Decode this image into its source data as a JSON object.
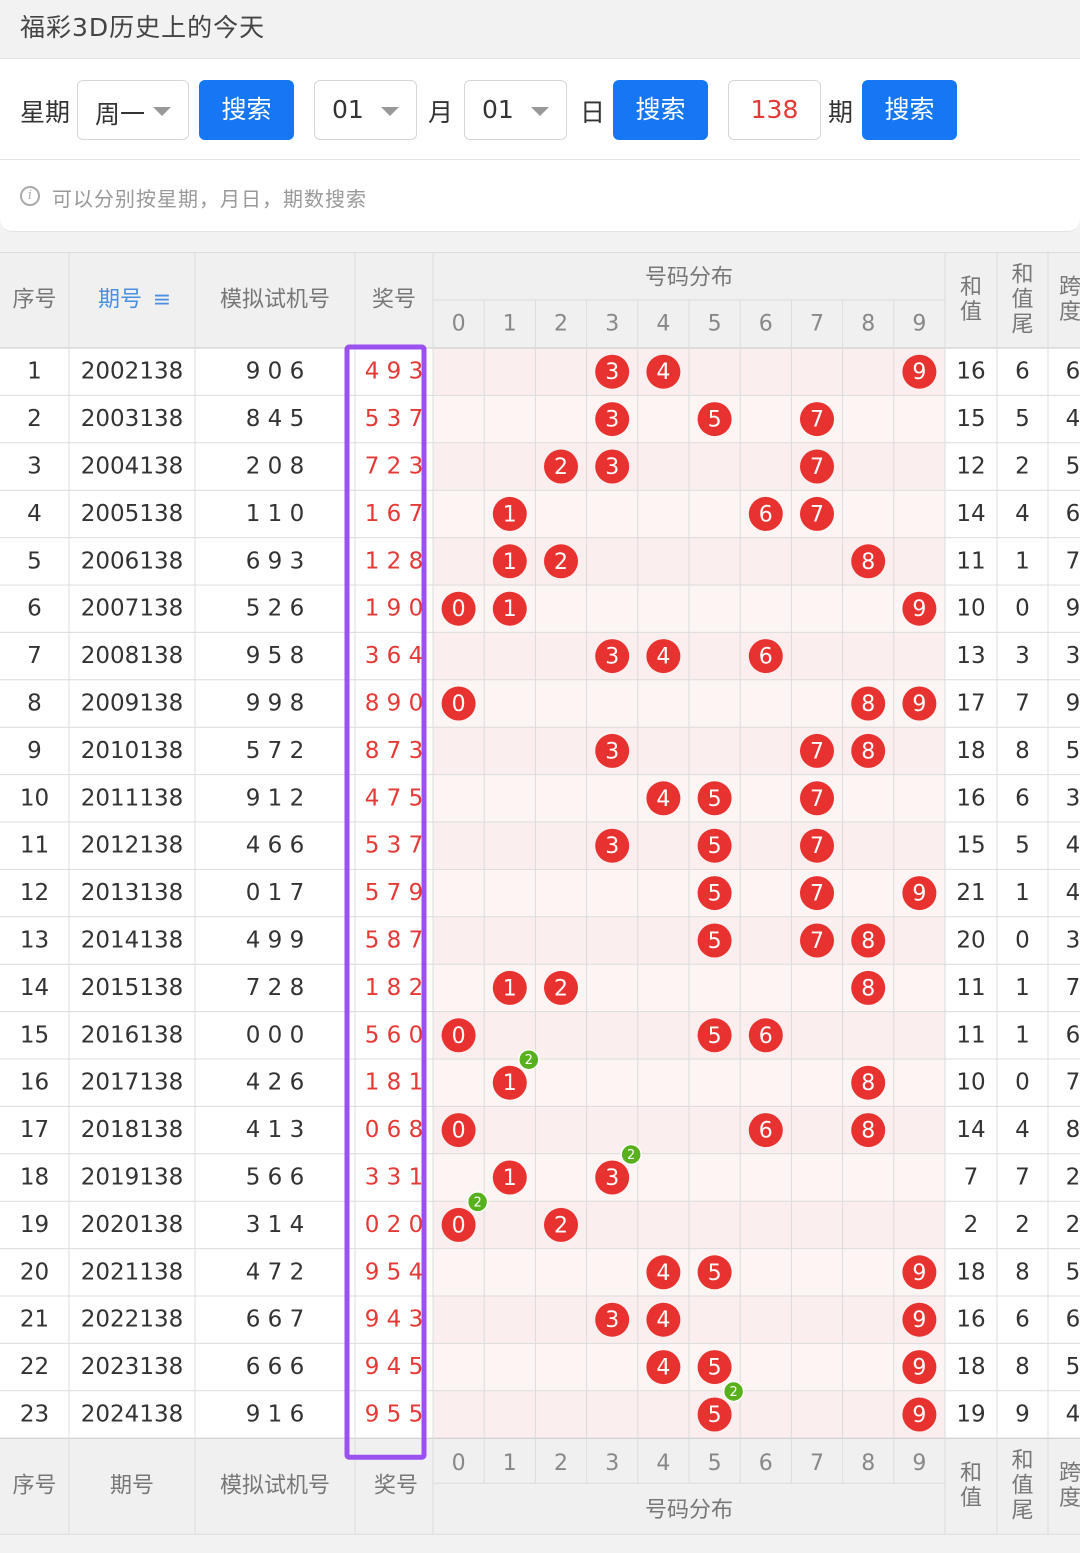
{
  "page": {
    "title": "福彩3D历史上的今天"
  },
  "search": {
    "weekday_label": "星期",
    "weekday_value": "周一",
    "search_label": "搜索",
    "month_value": "01",
    "month_label": "月",
    "day_value": "01",
    "day_label": "日",
    "issue_value": "138",
    "issue_label": "期"
  },
  "hint": "可以分别按星期，月日，期数搜索",
  "table": {
    "header": {
      "seq": "序号",
      "issue": "期号",
      "sort_icon": "≡",
      "trial": "模拟试机号",
      "prize": "奖号",
      "dist": "号码分布",
      "digits": [
        "0",
        "1",
        "2",
        "3",
        "4",
        "5",
        "6",
        "7",
        "8",
        "9"
      ],
      "sum": "和值",
      "sum_tail": "和值尾",
      "span": "跨度"
    },
    "footer": {
      "seq": "序号",
      "issue": "期号",
      "trial": "模拟试机号",
      "prize": "奖号",
      "dist": "号码分布",
      "sum": "和值",
      "sum_tail": "和值尾",
      "span": "跨度"
    },
    "rows": [
      {
        "seq": "1",
        "issue": "2002138",
        "trial": "9 0 6",
        "prize": "4 9 3",
        "sum": "16",
        "tail": "6",
        "span": "6"
      },
      {
        "seq": "2",
        "issue": "2003138",
        "trial": "8 4 5",
        "prize": "5 3 7",
        "sum": "15",
        "tail": "5",
        "span": "4"
      },
      {
        "seq": "3",
        "issue": "2004138",
        "trial": "2 0 8",
        "prize": "7 2 3",
        "sum": "12",
        "tail": "2",
        "span": "5"
      },
      {
        "seq": "4",
        "issue": "2005138",
        "trial": "1 1 0",
        "prize": "1 6 7",
        "sum": "14",
        "tail": "4",
        "span": "6"
      },
      {
        "seq": "5",
        "issue": "2006138",
        "trial": "6 9 3",
        "prize": "1 2 8",
        "sum": "11",
        "tail": "1",
        "span": "7"
      },
      {
        "seq": "6",
        "issue": "2007138",
        "trial": "5 2 6",
        "prize": "1 9 0",
        "sum": "10",
        "tail": "0",
        "span": "9"
      },
      {
        "seq": "7",
        "issue": "2008138",
        "trial": "9 5 8",
        "prize": "3 6 4",
        "sum": "13",
        "tail": "3",
        "span": "3"
      },
      {
        "seq": "8",
        "issue": "2009138",
        "trial": "9 9 8",
        "prize": "8 9 0",
        "sum": "17",
        "tail": "7",
        "span": "9"
      },
      {
        "seq": "9",
        "issue": "2010138",
        "trial": "5 7 2",
        "prize": "8 7 3",
        "sum": "18",
        "tail": "8",
        "span": "5"
      },
      {
        "seq": "10",
        "issue": "2011138",
        "trial": "9 1 2",
        "prize": "4 7 5",
        "sum": "16",
        "tail": "6",
        "span": "3"
      },
      {
        "seq": "11",
        "issue": "2012138",
        "trial": "4 6 6",
        "prize": "5 3 7",
        "sum": "15",
        "tail": "5",
        "span": "4"
      },
      {
        "seq": "12",
        "issue": "2013138",
        "trial": "0 1 7",
        "prize": "5 7 9",
        "sum": "21",
        "tail": "1",
        "span": "4"
      },
      {
        "seq": "13",
        "issue": "2014138",
        "trial": "4 9 9",
        "prize": "5 8 7",
        "sum": "20",
        "tail": "0",
        "span": "3"
      },
      {
        "seq": "14",
        "issue": "2015138",
        "trial": "7 2 8",
        "prize": "1 8 2",
        "sum": "11",
        "tail": "1",
        "span": "7"
      },
      {
        "seq": "15",
        "issue": "2016138",
        "trial": "0 0 0",
        "prize": "5 6 0",
        "sum": "11",
        "tail": "1",
        "span": "6"
      },
      {
        "seq": "16",
        "issue": "2017138",
        "trial": "4 2 6",
        "prize": "1 8 1",
        "sum": "10",
        "tail": "0",
        "span": "7"
      },
      {
        "seq": "17",
        "issue": "2018138",
        "trial": "4 1 3",
        "prize": "0 6 8",
        "sum": "14",
        "tail": "4",
        "span": "8"
      },
      {
        "seq": "18",
        "issue": "2019138",
        "trial": "5 6 6",
        "prize": "3 3 1",
        "sum": "7",
        "tail": "7",
        "span": "2"
      },
      {
        "seq": "19",
        "issue": "2020138",
        "trial": "3 1 4",
        "prize": "0 2 0",
        "sum": "2",
        "tail": "2",
        "span": "2"
      },
      {
        "seq": "20",
        "issue": "2021138",
        "trial": "4 7 2",
        "prize": "9 5 4",
        "sum": "18",
        "tail": "8",
        "span": "5"
      },
      {
        "seq": "21",
        "issue": "2022138",
        "trial": "6 6 7",
        "prize": "9 4 3",
        "sum": "16",
        "tail": "6",
        "span": "6"
      },
      {
        "seq": "22",
        "issue": "2023138",
        "trial": "6 6 6",
        "prize": "9 4 5",
        "sum": "18",
        "tail": "8",
        "span": "5"
      },
      {
        "seq": "23",
        "issue": "2024138",
        "trial": "9 1 6",
        "prize": "9 5 5",
        "sum": "19",
        "tail": "9",
        "span": "4"
      }
    ]
  },
  "colors": {
    "accent_blue": "#1677f5",
    "ball_red": "#e8322f",
    "repeat_badge_green": "#58b01c",
    "highlight_purple": "#9b50f0",
    "prize_text_red": "#e53935",
    "row_tint": "#fdf0f0"
  }
}
